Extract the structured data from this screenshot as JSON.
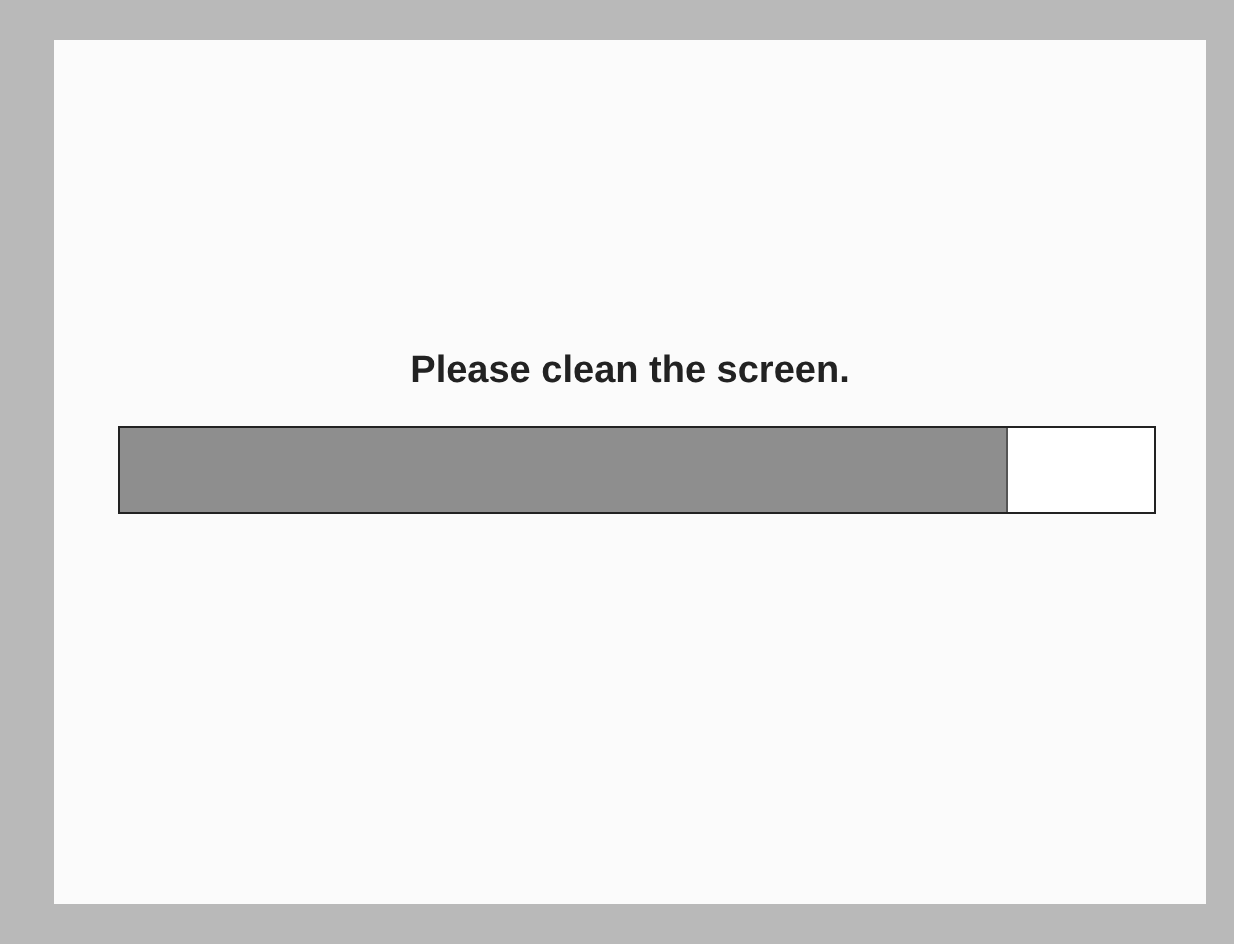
{
  "message": "Please clean the screen.",
  "progress": {
    "level": 0.86
  }
}
